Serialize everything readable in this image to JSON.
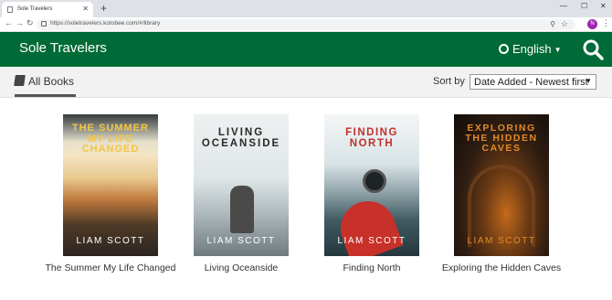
{
  "browser": {
    "tab_title": "Sole Travelers",
    "new_tab": "+",
    "url": "https://soletravelers.kotobee.com/#/library",
    "profile_initial": "N"
  },
  "header": {
    "brand": "Sole Travelers",
    "language": "English",
    "accent": "#006b36"
  },
  "toolbar": {
    "all_books": "All Books",
    "sort_label": "Sort by",
    "sort_value": "Date Added - Newest first"
  },
  "books": [
    {
      "cover_title": "THE SUMMER\nMY LIFE\nCHANGED",
      "author": "LIAM SCOTT",
      "caption": "The Summer My Life Changed"
    },
    {
      "cover_title": "LIVING\nOCEANSIDE",
      "author": "LIAM SCOTT",
      "caption": "Living Oceanside"
    },
    {
      "cover_title": "FINDING\nNORTH",
      "author": "LIAM SCOTT",
      "caption": "Finding North"
    },
    {
      "cover_title": "EXPLORING\nTHE HIDDEN\nCAVES",
      "author": "LIAM SCOTT",
      "caption": "Exploring the Hidden Caves"
    }
  ]
}
